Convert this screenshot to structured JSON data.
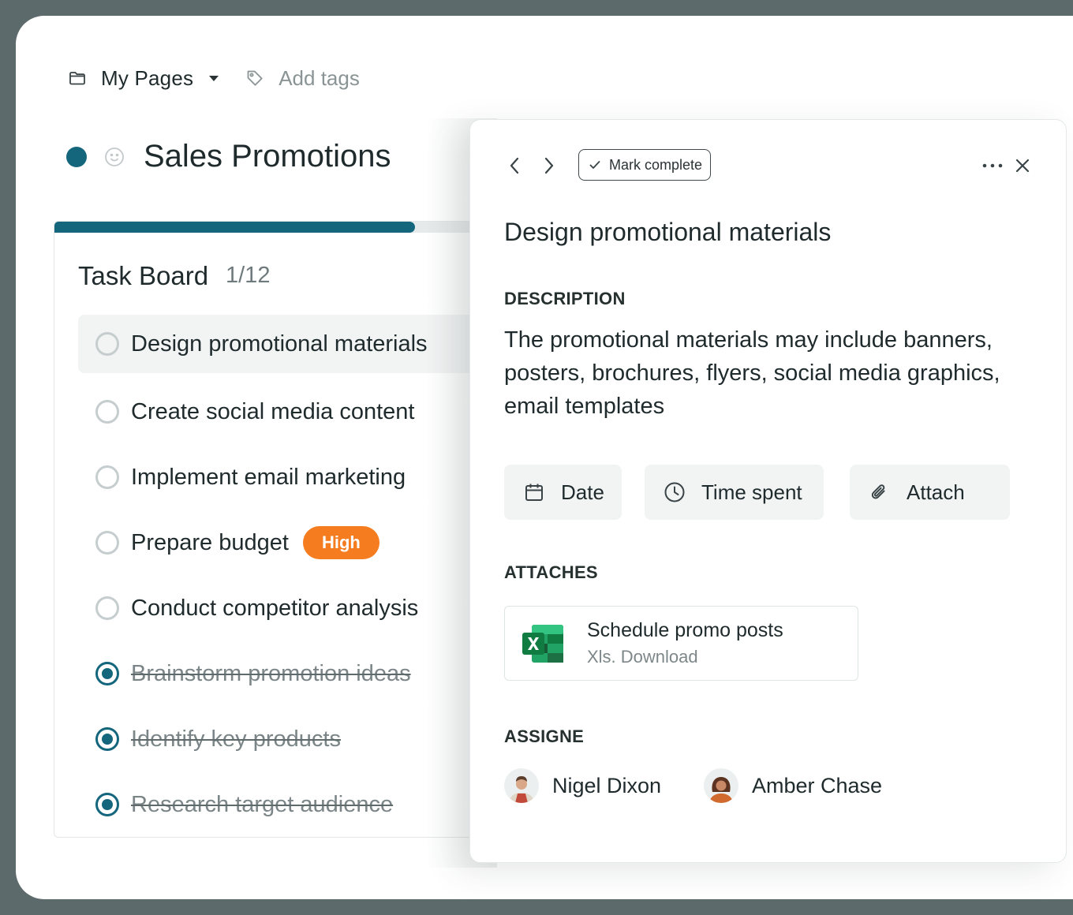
{
  "topbar": {
    "folder_label": "My Pages",
    "add_tags_label": "Add tags"
  },
  "page": {
    "title": "Sales Promotions",
    "status_color": "#14667d"
  },
  "board": {
    "title": "Task Board",
    "count": "1/12",
    "progress_fraction": 0.765,
    "tasks": [
      {
        "label": "Design promotional materials",
        "done": false,
        "selected": true
      },
      {
        "label": "Create social media content",
        "done": false
      },
      {
        "label": "Implement email marketing",
        "done": false
      },
      {
        "label": "Prepare budget",
        "done": false,
        "badge": "High"
      },
      {
        "label": "Conduct competitor analysis",
        "done": false
      },
      {
        "label": "Brainstorm promotion ideas",
        "done": true
      },
      {
        "label": "Identify key products",
        "done": true
      },
      {
        "label": "Research target audience",
        "done": true
      }
    ]
  },
  "detail": {
    "mark_complete_label": "Mark complete",
    "title": "Design promotional materials",
    "description_heading": "DESCRIPTION",
    "description": "The promotional materials may include banners, posters, brochures, flyers, social media graphics, email templates",
    "actions": {
      "date_label": "Date",
      "time_label": "Time spent",
      "attach_label": "Attach"
    },
    "attaches_heading": "ATTACHES",
    "attachment": {
      "name": "Schedule promo posts",
      "subtitle": "Xls. Download"
    },
    "assignee_heading": "ASSIGNE",
    "assignees": [
      {
        "name": "Nigel Dixon"
      },
      {
        "name": "Amber Chase"
      }
    ]
  },
  "colors": {
    "accent": "#14667d",
    "badge_high": "#f57c1f",
    "excel_green": "#1d7044"
  }
}
